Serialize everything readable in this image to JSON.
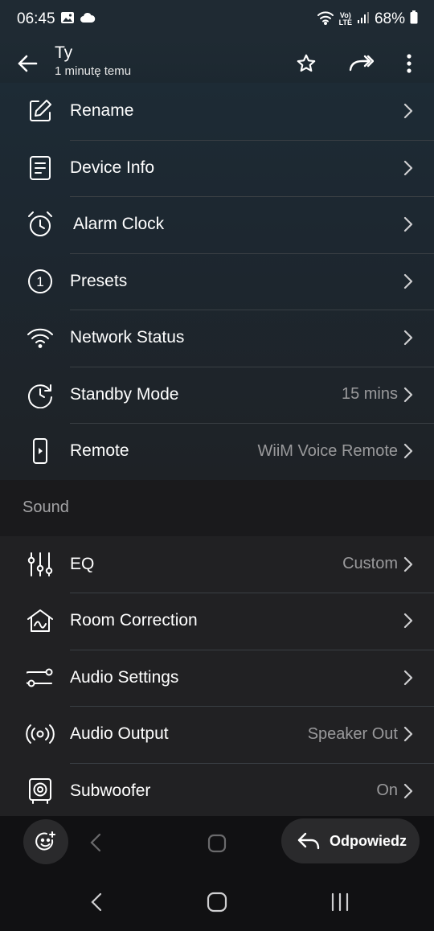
{
  "status_bar": {
    "time": "06:45",
    "lte_top": "Vo)",
    "lte_bottom": "LTE",
    "battery": "68%"
  },
  "header": {
    "title": "Ty",
    "subtitle": "1 minutę temu",
    "icons": [
      "back-arrow-icon",
      "star-icon",
      "forward-icon",
      "more-vert-icon"
    ]
  },
  "settings": {
    "items": [
      {
        "label": "Rename",
        "value": "",
        "icon": "edit-icon"
      },
      {
        "label": "Device Info",
        "value": "",
        "icon": "document-icon"
      },
      {
        "label": "Alarm Clock",
        "value": "",
        "icon": "alarm-clock-icon"
      },
      {
        "label": "Presets",
        "value": "",
        "icon": "preset-number-icon"
      },
      {
        "label": "Network Status",
        "value": "",
        "icon": "wifi-icon"
      },
      {
        "label": "Standby Mode",
        "value": "15 mins",
        "icon": "standby-clock-icon"
      },
      {
        "label": "Remote",
        "value": "WiiM Voice Remote",
        "icon": "remote-icon"
      }
    ],
    "preset_number": "1"
  },
  "sound": {
    "header": "Sound",
    "items": [
      {
        "label": "EQ",
        "value": "Custom",
        "icon": "equalizer-icon"
      },
      {
        "label": "Room Correction",
        "value": "",
        "icon": "room-correction-icon"
      },
      {
        "label": "Audio Settings",
        "value": "",
        "icon": "audio-settings-icon"
      },
      {
        "label": "Audio Output",
        "value": "Speaker Out",
        "icon": "broadcast-icon"
      },
      {
        "label": "Subwoofer",
        "value": "On",
        "icon": "subwoofer-icon"
      }
    ]
  },
  "reply_bar": {
    "reply_label": "Odpowiedz"
  },
  "colors": {
    "background": "#1b1b1d",
    "value_text": "#9a9a9c",
    "divider": "#3a3f44"
  }
}
